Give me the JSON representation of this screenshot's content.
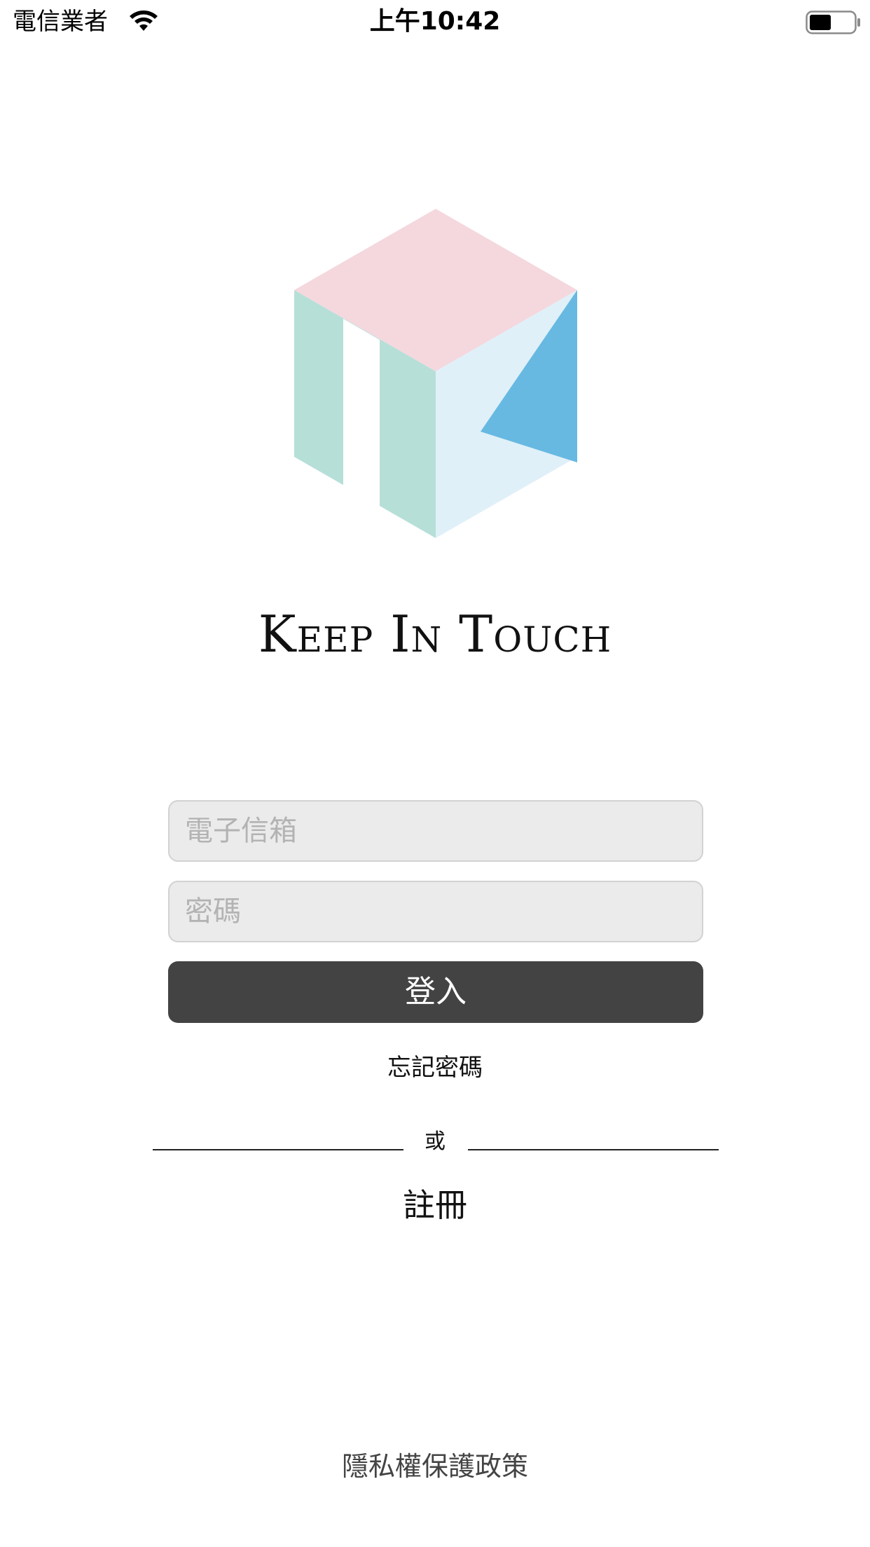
{
  "status_bar": {
    "carrier": "電信業者",
    "time": "上午10:42",
    "wifi_icon": "wifi-icon",
    "battery_icon": "battery-icon"
  },
  "brand": {
    "logo_icon": "cube-logo-icon",
    "title": "Keep In Touch",
    "colors": {
      "top": "#f4d8de",
      "left": "#b6dfd8",
      "right": "#e0f0f8",
      "accent": "#67b9e2"
    }
  },
  "form": {
    "email_placeholder": "電子信箱",
    "password_placeholder": "密碼",
    "login_label": "登入",
    "forgot_label": "忘記密碼",
    "divider_label": "或",
    "register_label": "註冊"
  },
  "footer": {
    "privacy_label": "隱私權保護政策"
  }
}
